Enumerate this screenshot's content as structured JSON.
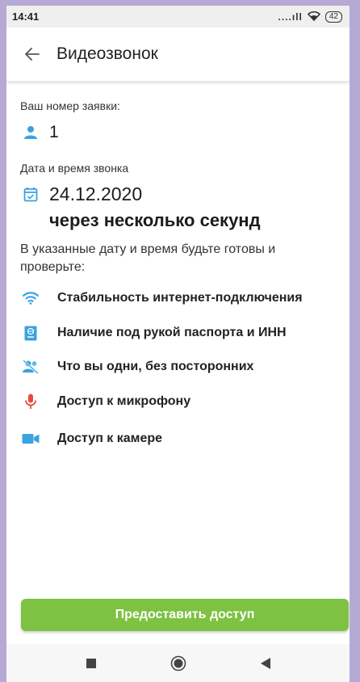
{
  "status_bar": {
    "time": "14:41",
    "signal": "....ıll",
    "battery": "42",
    "icons": [
      "signal-icon",
      "wifi-icon",
      "battery-icon"
    ]
  },
  "app_bar": {
    "title": "Видеозвонок",
    "back_icon": "arrow-left-icon"
  },
  "request": {
    "label": "Ваш номер заявки:",
    "icon": "person-icon",
    "number": "1"
  },
  "call": {
    "label": "Дата и время звонка",
    "icon": "calendar-check-icon",
    "date": "24.12.2020",
    "relative": "через несколько секунд"
  },
  "instruction": "В указанные дату и время будьте готовы и проверьте:",
  "checklist": [
    {
      "icon": "wifi-icon",
      "color": "#3aa3e0",
      "label": "Стабильность интернет-подключения"
    },
    {
      "icon": "passport-icon",
      "color": "#3aa3e0",
      "label": "Наличие под рукой паспорта и ИНН"
    },
    {
      "icon": "people-off-icon",
      "color": "#3aa3e0",
      "label": "Что вы одни, без посторонних"
    },
    {
      "icon": "microphone-icon",
      "color": "#e8493f",
      "label": "Доступ к микрофону"
    },
    {
      "icon": "camera-icon",
      "color": "#3aa3e0",
      "label": "Доступ к камере"
    }
  ],
  "grant_button": {
    "label": "Предоставить доступ",
    "color": "#7dc242"
  },
  "nav_bar": {
    "icons": [
      "recents-square-icon",
      "home-circle-icon",
      "back-triangle-icon"
    ]
  },
  "colors": {
    "accent": "#3aa3e0",
    "mic": "#e8493f",
    "button": "#7dc242",
    "frame": "#b6a9d3"
  }
}
